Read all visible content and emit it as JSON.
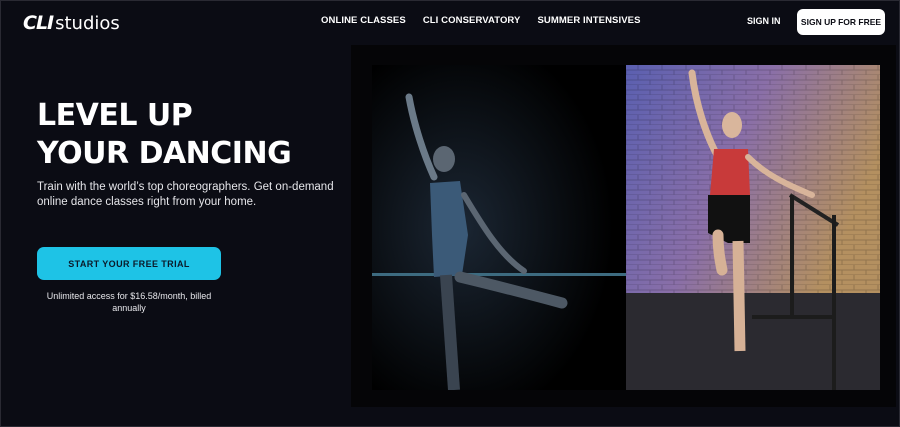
{
  "header": {
    "logo_mark": "CLI",
    "logo_word": "studios",
    "nav": [
      {
        "label": "ONLINE CLASSES"
      },
      {
        "label": "CLI CONSERVATORY"
      },
      {
        "label": "SUMMER INTENSIVES"
      }
    ],
    "sign_in": "SIGN IN",
    "sign_up": "SIGN UP FOR FREE"
  },
  "hero": {
    "headline_line1": "LEVEL UP",
    "headline_line2": "YOUR DANCING",
    "subcopy": "Train with the world’s top choreographers. Get on-demand online dance classes right from your home.",
    "cta": "START YOUR FREE TRIAL",
    "pricing": "Unlimited access for $16.58/month, billed annually"
  },
  "media": {
    "left_panel": "dancer-at-barre-dark-image",
    "right_panel": "dancer-brick-wall-image"
  },
  "colors": {
    "background": "#0b0c14",
    "accent": "#1ec3e6",
    "button_light": "#ffffff"
  }
}
